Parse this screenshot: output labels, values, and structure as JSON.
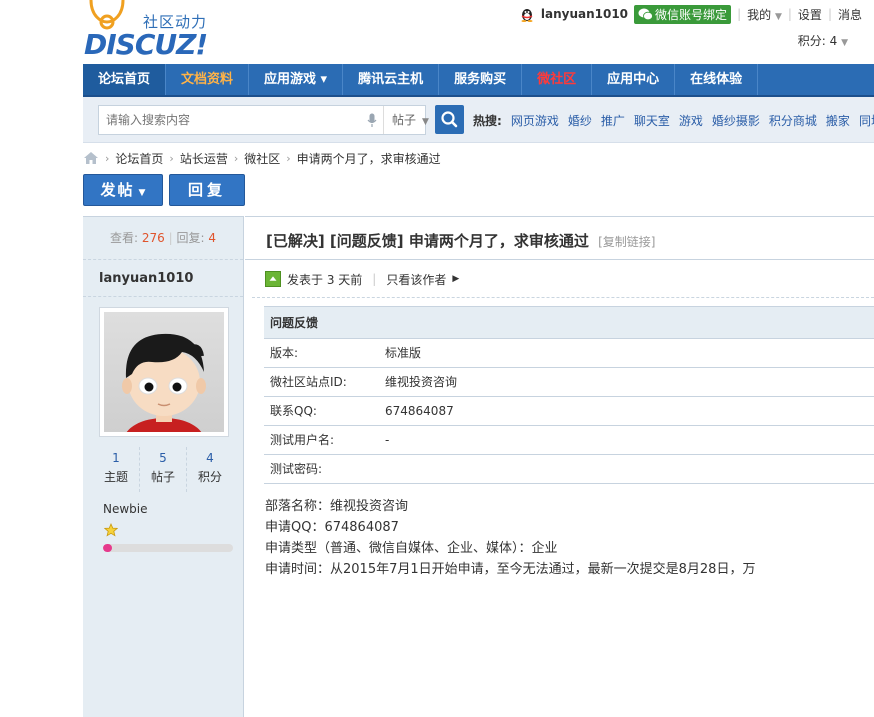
{
  "header": {
    "logo_sub": "社区动力",
    "logo_main": "DISCUZ!",
    "username": "lanyuan1010",
    "wechat_bind": "微信账号绑定",
    "my": "我的",
    "settings": "设置",
    "messages": "消息",
    "score": "积分: 4"
  },
  "nav": {
    "items": [
      {
        "label": "论坛首页"
      },
      {
        "label": "文档资料"
      },
      {
        "label": "应用游戏 ▾"
      },
      {
        "label": "腾讯云主机"
      },
      {
        "label": "服务购买"
      },
      {
        "label": "微社区"
      },
      {
        "label": "应用中心"
      },
      {
        "label": "在线体验"
      }
    ]
  },
  "search": {
    "placeholder": "请输入搜索内容",
    "type": "帖子",
    "hot_label": "热搜:",
    "hot_words": [
      "网页游戏",
      "婚纱",
      "推广",
      "聊天室",
      "游戏",
      "婚纱摄影",
      "积分商城",
      "搬家",
      "同城"
    ]
  },
  "breadcrumb": [
    "论坛首页",
    "站长运营",
    "微社区",
    "申请两个月了，求审核通过"
  ],
  "actions": {
    "post": "发帖",
    "reply": "回复"
  },
  "thread": {
    "views_label": "查看:",
    "views": "276",
    "replies_label": "回复:",
    "replies": "4",
    "title": "[已解决] [问题反馈] 申请两个月了，求审核通过",
    "copy_link": "[复制链接]"
  },
  "author": {
    "name": "lanyuan1010",
    "stats": [
      {
        "value": "1",
        "label": "主题"
      },
      {
        "value": "5",
        "label": "帖子"
      },
      {
        "value": "4",
        "label": "积分"
      }
    ],
    "rank": "Newbie",
    "progress": 0.07
  },
  "post": {
    "posted": "发表于 3 天前",
    "only_author": "只看该作者",
    "table_title": "问题反馈",
    "rows": [
      {
        "key": "版本:",
        "value": "标准版"
      },
      {
        "key": "微社区站点ID:",
        "value": "维视投资咨询"
      },
      {
        "key": "联系QQ:",
        "value": "674864087"
      },
      {
        "key": "测试用户名:",
        "value": "-"
      },
      {
        "key": "测试密码:",
        "value": ""
      }
    ],
    "body": [
      "部落名称：维视投资咨询",
      "申请QQ：674864087",
      "申请类型（普通、微信自媒体、企业、媒体）：企业",
      "申请时间：从2015年7月1日开始申请，至今无法通过，最新一次提交是8月28日，万"
    ]
  },
  "colors": {
    "nav_bg": "#2b6cb4",
    "accent_orange": "#ffb347",
    "accent_red": "#ff3a3a",
    "count_red": "#e0542c",
    "link_blue": "#2b5ea8",
    "wechat_green": "#3a9a3a"
  }
}
